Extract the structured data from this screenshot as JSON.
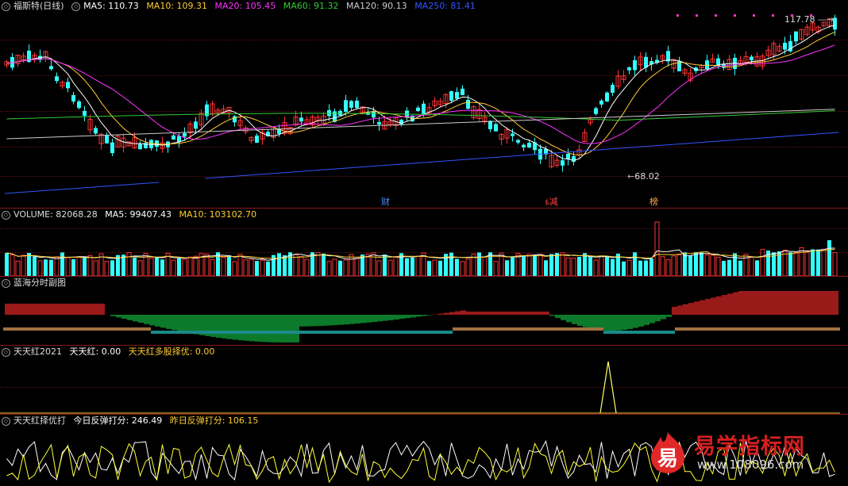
{
  "main": {
    "title": "福斯特(日线)",
    "ma": [
      {
        "label": "MA5: 110.73",
        "color": "#ffffff"
      },
      {
        "label": "MA10: 109.31",
        "color": "#ffcc33"
      },
      {
        "label": "MA20: 105.45",
        "color": "#ff33ff"
      },
      {
        "label": "MA60: 91.32",
        "color": "#33cc33"
      },
      {
        "label": "MA120: 90.13",
        "color": "#cccccc"
      },
      {
        "label": "MA250: 81.41",
        "color": "#3355ff"
      }
    ],
    "high_label": "117.78",
    "low_label": "68.02",
    "events": [
      {
        "label": "财",
        "color": "#4a8cff"
      },
      {
        "label": "减",
        "color": "#ff4444",
        "prefix": "$"
      },
      {
        "label": "榜",
        "color": "#ffaa55"
      }
    ]
  },
  "volume": {
    "title": "VOLUME: 82068.28",
    "ma5": "MA5: 99407.43",
    "ma10": "MA10: 103102.70"
  },
  "lanhai": {
    "title": "蓝海分时副图"
  },
  "tth": {
    "title": "天天红2021",
    "v1": "天天红: 0.00",
    "v2": "天天红多股择优: 0.00"
  },
  "score": {
    "title": "天天红择优打",
    "today": "今日反弹打分: 246.49",
    "yesterday": "昨日反弹打分: 106.15"
  },
  "watermark": {
    "logo_char": "易",
    "title": "易学指标网",
    "url": "www.108096.com"
  },
  "colors": {
    "up": "#ff3333",
    "down": "#33ffff",
    "grid": "#5a1010",
    "separator": "#8a1a1a"
  }
}
